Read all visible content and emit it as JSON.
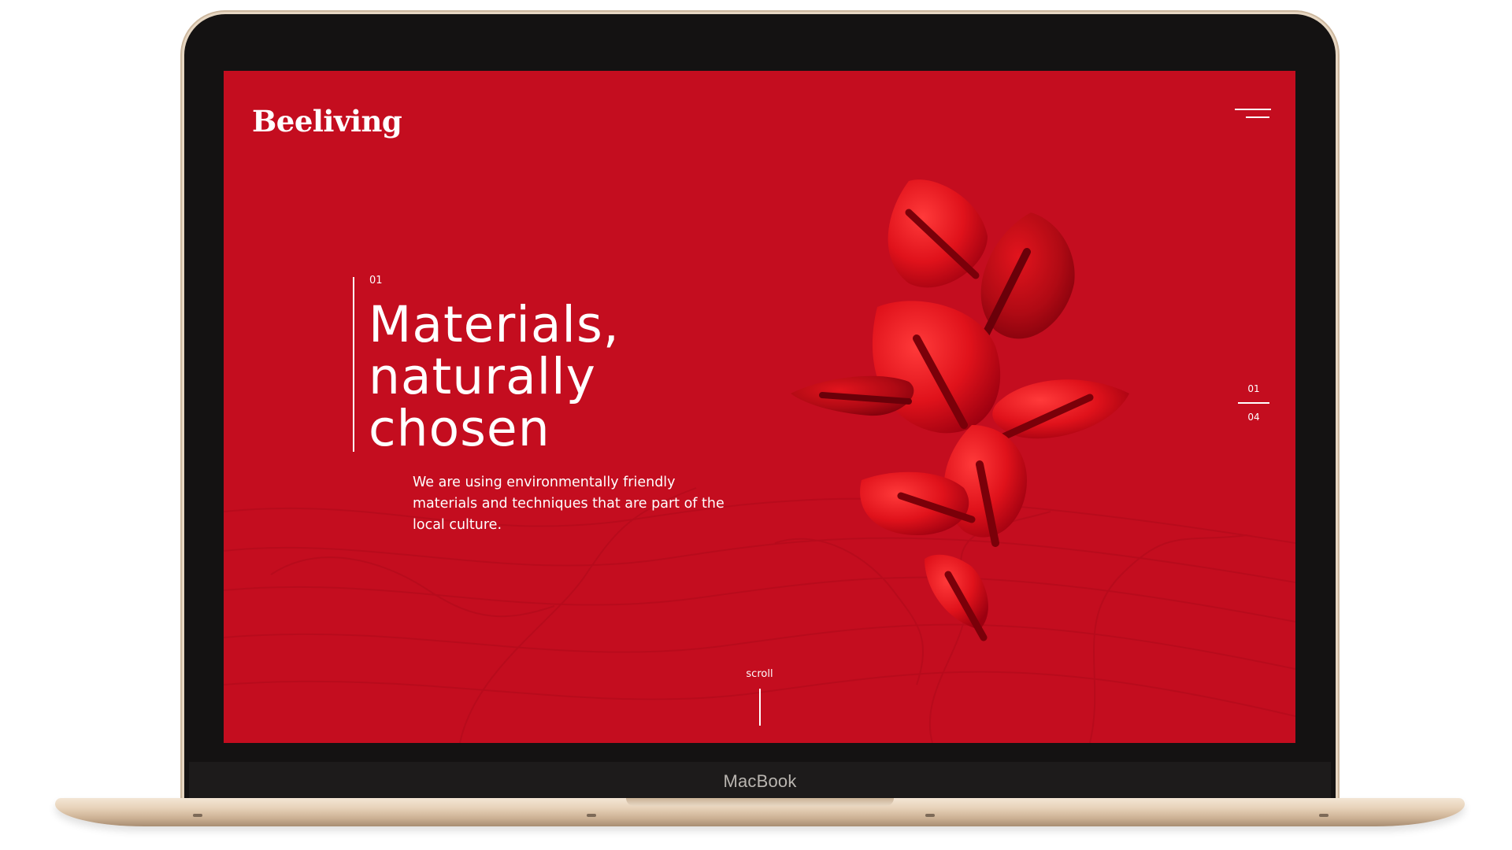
{
  "device": {
    "brand_label": "MacBook"
  },
  "site": {
    "logo": "Beeliving",
    "menu_icon": "hamburger-menu-icon"
  },
  "hero": {
    "slide_number": "01",
    "headline_lines": [
      "Materials,",
      "naturally",
      "chosen"
    ],
    "description": "We are using environmentally friendly materials and techniques that are part of the local culture."
  },
  "pager": {
    "current": "01",
    "total": "04"
  },
  "scroll": {
    "label": "scroll"
  },
  "colors": {
    "background_red": "#c40d1f",
    "leaf_red": "#e0121b",
    "text": "#ffffff"
  }
}
